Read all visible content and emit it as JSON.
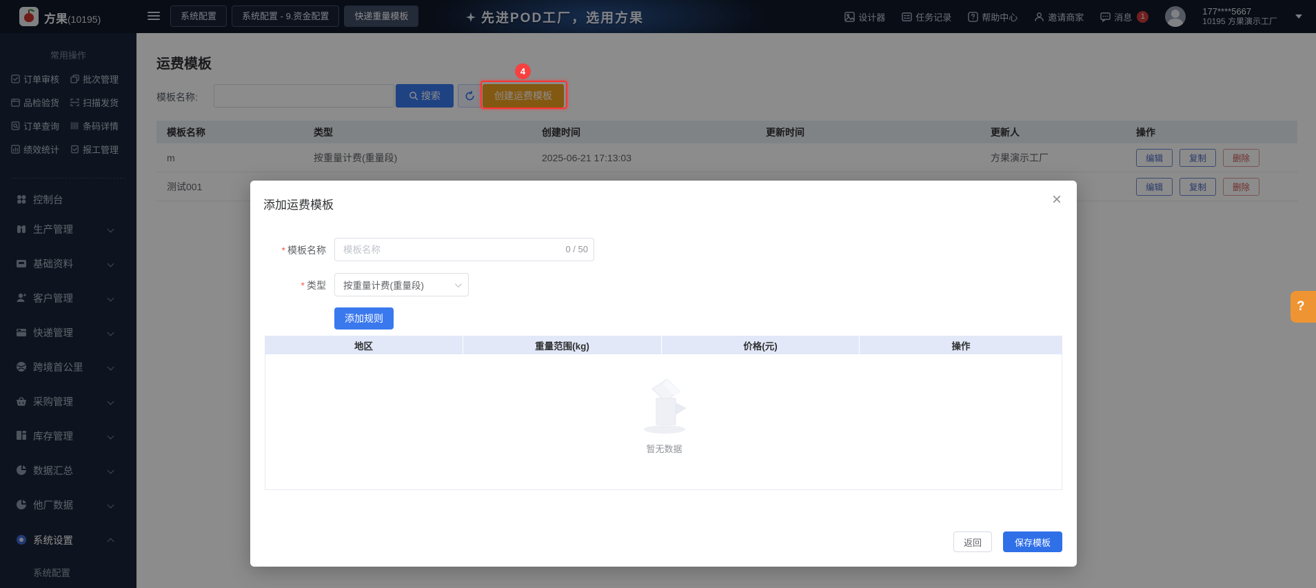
{
  "topbar": {
    "logo_text": "方果",
    "logo_badge": "(10195)",
    "tabs": [
      {
        "label": "系统配置"
      },
      {
        "label": "系统配置 - 9.资金配置"
      },
      {
        "label": "快递重量模板"
      }
    ],
    "banner": "先进POD工厂，选用方果",
    "nav": {
      "designer": "设计器",
      "tasks": "任务记录",
      "help": "帮助中心",
      "invite": "邀请商家",
      "messages": "消息",
      "message_count": "1"
    },
    "user": {
      "phone": "177****5667",
      "factory": "10195 方果演示工厂"
    }
  },
  "sidebar": {
    "quick_title": "常用操作",
    "quick_items": [
      {
        "label": "订单审核"
      },
      {
        "label": "批次管理"
      },
      {
        "label": "品检验货"
      },
      {
        "label": "扫描发货"
      },
      {
        "label": "订单查询"
      },
      {
        "label": "条码详情"
      },
      {
        "label": "绩效统计"
      },
      {
        "label": "报工管理"
      }
    ],
    "menu": [
      {
        "label": "控制台"
      },
      {
        "label": "生产管理"
      },
      {
        "label": "基础资料"
      },
      {
        "label": "客户管理"
      },
      {
        "label": "快递管理"
      },
      {
        "label": "跨境首公里"
      },
      {
        "label": "采购管理"
      },
      {
        "label": "库存管理"
      },
      {
        "label": "数据汇总"
      },
      {
        "label": "他厂数据"
      },
      {
        "label": "系统设置"
      }
    ],
    "submenu": [
      {
        "label": "系统配置"
      }
    ]
  },
  "page": {
    "title": "运费模板",
    "filter_label": "模板名称:",
    "search_label": "搜索",
    "create_label": "创建运费模板",
    "annotation_badge": "4",
    "table": {
      "headers": [
        "模板名称",
        "类型",
        "创建时间",
        "更新时间",
        "更新人",
        "操作"
      ],
      "rows": [
        {
          "name": "m",
          "type": "按重量计费(重量段)",
          "created": "2025-06-21 17:13:03",
          "updated": "",
          "updater": "方果演示工厂"
        },
        {
          "name": "测试001",
          "type": "",
          "created": "",
          "updated": "",
          "updater": ""
        }
      ],
      "row_actions": [
        "编辑",
        "复制",
        "删除"
      ]
    }
  },
  "modal": {
    "title": "添加运费模板",
    "required_mark": "*",
    "close_glyph": "×",
    "name_label": "模板名称",
    "name_placeholder": "模板名称",
    "name_counter": "0 / 50",
    "type_label": "类型",
    "type_value": "按重量计费(重量段)",
    "add_rule": "添加规则",
    "headers": [
      "地区",
      "重量范围(kg)",
      "价格(元)",
      "操作"
    ],
    "empty": "暂无数据",
    "back": "返回",
    "save": "保存模板"
  },
  "help": {
    "label": "?"
  },
  "colors": {
    "primary": "#3a78ee",
    "create_button": "#efa020",
    "annotation_red": "#ff3232",
    "topbar_bg": "#101828",
    "sidebar_bg": "#1b2539",
    "modal_header_bg": "#e2e8f7"
  }
}
